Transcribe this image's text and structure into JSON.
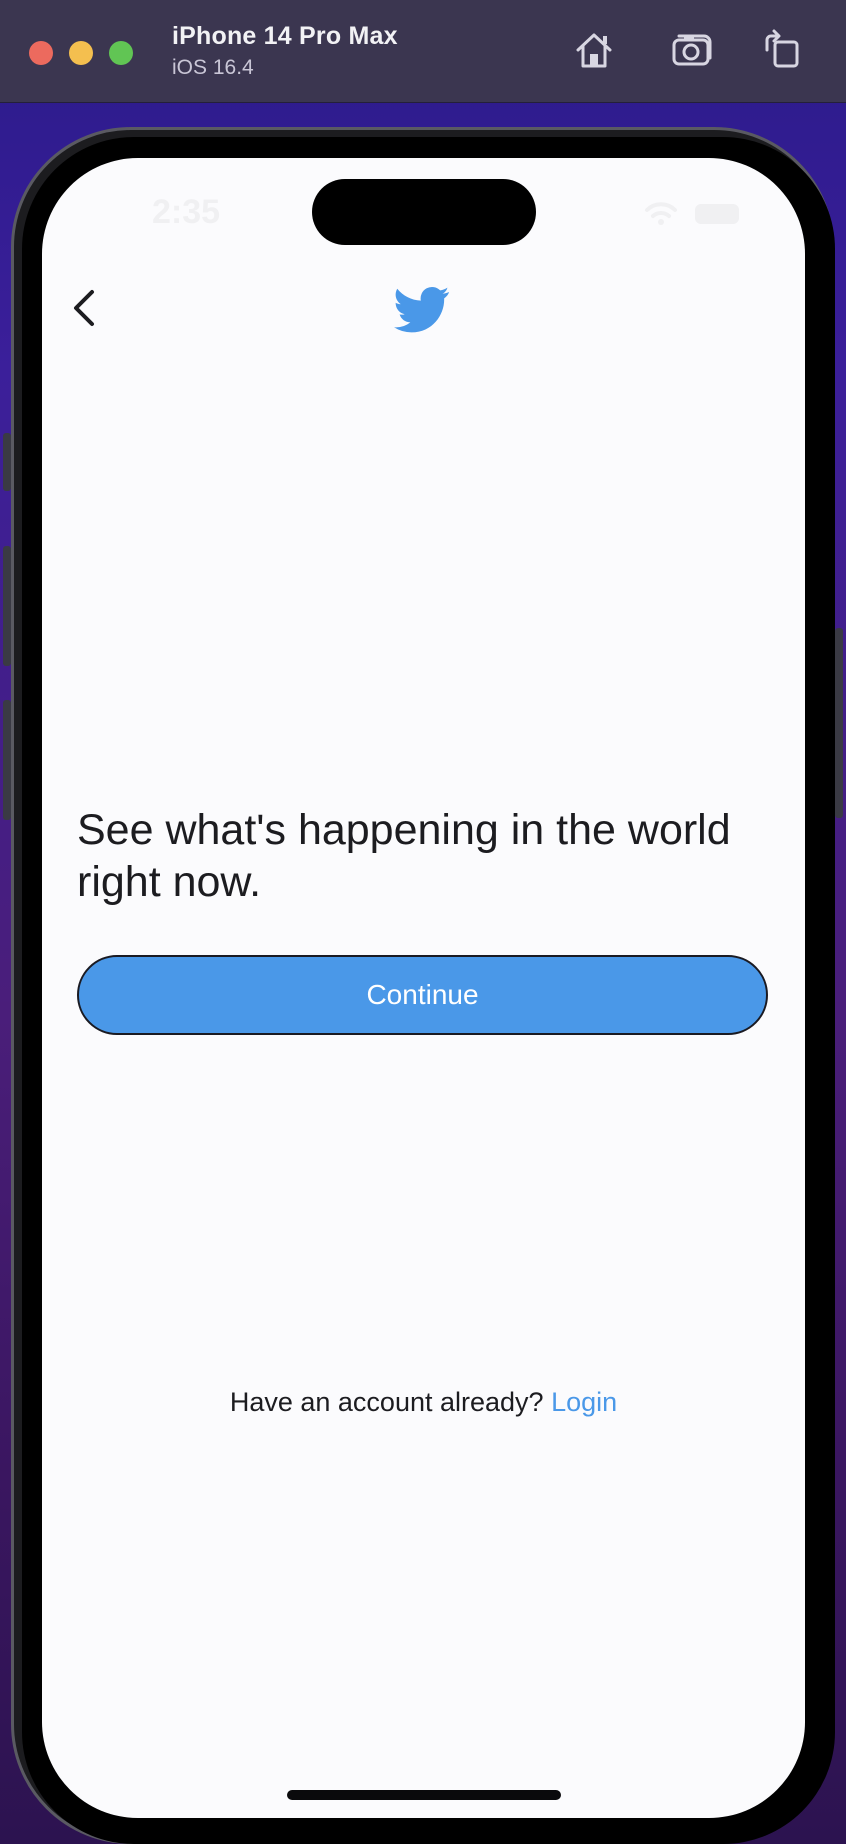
{
  "simulator": {
    "device_name": "iPhone 14 Pro Max",
    "os_version": "iOS 16.4",
    "toolbar_icons": [
      "home-icon",
      "screenshot-icon",
      "rotate-icon"
    ]
  },
  "status_bar": {
    "time": "2:35"
  },
  "nav": {
    "back_icon": "chevron-left-icon",
    "logo_icon": "twitter-bird-icon"
  },
  "main": {
    "headline": "See what's happening in the world right now.",
    "continue_label": "Continue"
  },
  "footer": {
    "prompt": "Have an account already?",
    "login_label": "Login"
  },
  "colors": {
    "brand_blue": "#4a98e8",
    "screen_bg": "#fbfbfd",
    "text": "#1c1c20",
    "titlebar": "#3b3650"
  }
}
